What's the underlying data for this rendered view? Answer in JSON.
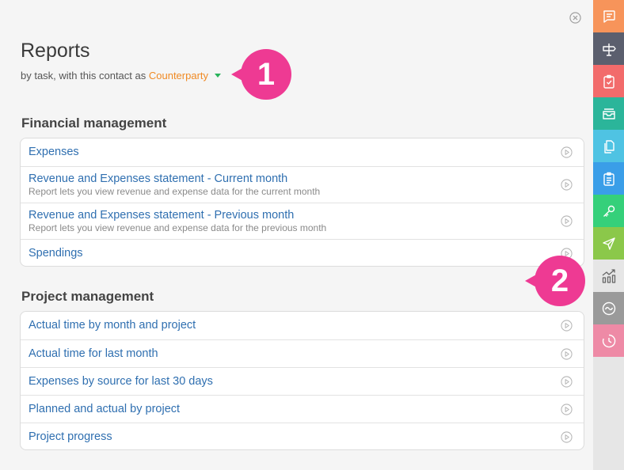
{
  "header": {
    "title": "Reports",
    "subtitle_prefix": "by task, with this contact as",
    "counterparty": "Counterparty"
  },
  "badges": {
    "one": "1",
    "two": "2"
  },
  "sections": [
    {
      "title": "Financial management",
      "items": [
        {
          "label": "Expenses",
          "desc": ""
        },
        {
          "label": "Revenue and Expenses statement - Current month",
          "desc": "Report lets you view revenue and expense data for the current month"
        },
        {
          "label": "Revenue and Expenses statement - Previous month",
          "desc": "Report lets you view revenue and expense data for the previous month"
        },
        {
          "label": "Spendings",
          "desc": ""
        }
      ]
    },
    {
      "title": "Project management",
      "items": [
        {
          "label": "Actual time by month and project",
          "desc": ""
        },
        {
          "label": "Actual time for last month",
          "desc": ""
        },
        {
          "label": "Expenses by source for last 30 days",
          "desc": ""
        },
        {
          "label": "Planned and actual by project",
          "desc": ""
        },
        {
          "label": "Project progress",
          "desc": ""
        }
      ]
    }
  ],
  "sidebar": [
    {
      "icon": "chat-icon",
      "color": "#f7945a"
    },
    {
      "icon": "signpost-icon",
      "color": "#5b5f6e"
    },
    {
      "icon": "task-icon",
      "color": "#f26b6b"
    },
    {
      "icon": "inbox-icon",
      "color": "#2bb59a"
    },
    {
      "icon": "documents-icon",
      "color": "#4fc3e3"
    },
    {
      "icon": "clipboard-icon",
      "color": "#3a9ee8"
    },
    {
      "icon": "key-icon",
      "color": "#35d07a"
    },
    {
      "icon": "send-icon",
      "color": "#8bc84a"
    },
    {
      "icon": "reports-icon",
      "color": "#e6e6e6"
    },
    {
      "icon": "chart-wave-icon",
      "color": "#9a9a9a"
    },
    {
      "icon": "clock-icon",
      "color": "#ee8aa6"
    }
  ],
  "colors": {
    "link": "#2f6fb0",
    "accent": "#f08a24",
    "badge": "#ee3a93"
  }
}
